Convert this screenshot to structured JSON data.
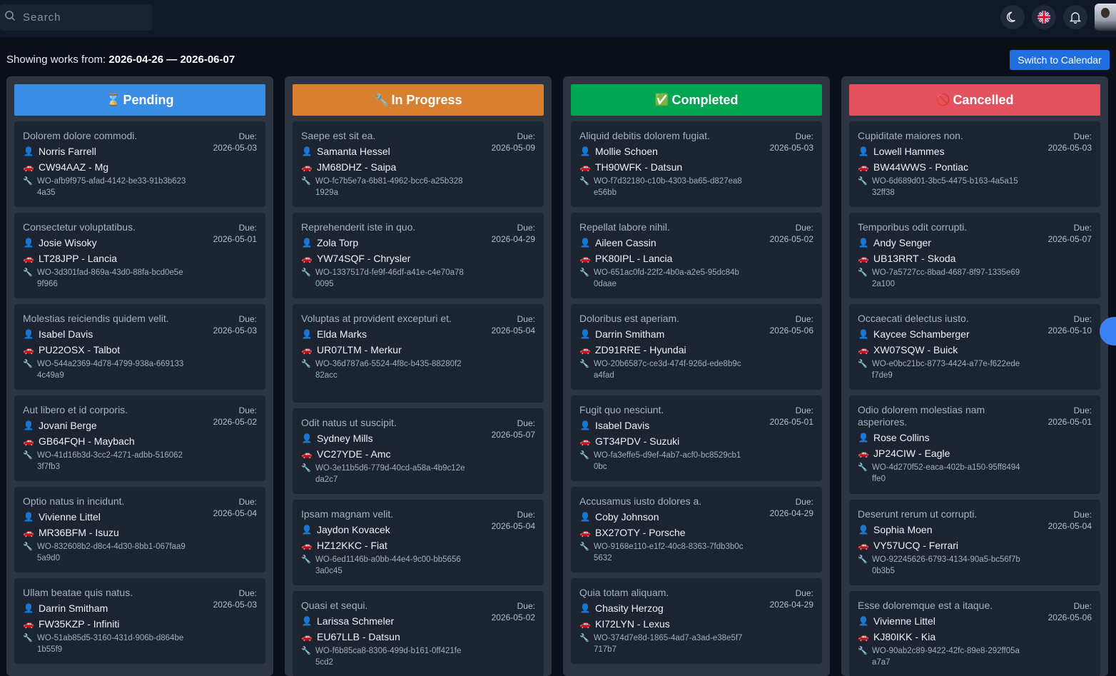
{
  "search": {
    "placeholder": "Search"
  },
  "header": {
    "prefix": "Showing works from: ",
    "range": "2026-04-26 — 2026-06-07",
    "switch_label": "Switch to Calendar"
  },
  "icons": {
    "theme": "moon-icon",
    "language": "uk-flag-icon",
    "notifications": "bell-icon"
  },
  "columns": [
    {
      "key": "pending",
      "label": "Pending",
      "emoji": "⌛",
      "color": "#3a8ee6",
      "cards": [
        {
          "title": "Dolorem dolore commodi.",
          "due_label": "Due:",
          "due": "2026-05-03",
          "person": "Norris Farrell",
          "vehicle": "CW94AAZ - Mg",
          "wo": "WO-afb9f975-afad-4142-be33-91b3b6234a35"
        },
        {
          "title": "Consectetur voluptatibus.",
          "due_label": "Due:",
          "due": "2026-05-01",
          "person": "Josie Wisoky",
          "vehicle": "LT28JPP - Lancia",
          "wo": "WO-3d301fad-869a-43d0-88fa-bcd0e5e9f966"
        },
        {
          "title": "Molestias reiciendis quidem velit.",
          "due_label": "Due:",
          "due": "2026-05-03",
          "person": "Isabel Davis",
          "vehicle": "PU22OSX - Talbot",
          "wo": "WO-544a2369-4d78-4799-938a-6691334c49a9"
        },
        {
          "title": "Aut libero et id corporis.",
          "due_label": "Due:",
          "due": "2026-05-02",
          "person": "Jovani Berge",
          "vehicle": "GB64FQH - Maybach",
          "wo": "WO-41d16b3d-3cc2-4271-adbb-5160623f7fb3"
        },
        {
          "title": "Optio natus in incidunt.",
          "due_label": "Due:",
          "due": "2026-05-04",
          "person": "Vivienne Littel",
          "vehicle": "MR36BFM - Isuzu",
          "wo": "WO-832608b2-d8c4-4d30-8bb1-067faa95a9d0"
        },
        {
          "title": "Ullam beatae quis natus.",
          "due_label": "Due:",
          "due": "2026-05-03",
          "person": "Darrin Smitham",
          "vehicle": "FW35KZP - Infiniti",
          "wo": "WO-51ab85d5-3160-431d-906b-d864be1b55f9"
        }
      ]
    },
    {
      "key": "in_progress",
      "label": "In Progress",
      "emoji": "🔧",
      "color": "#d98030",
      "cards": [
        {
          "title": "Saepe est sit ea.",
          "due_label": "Due:",
          "due": "2026-05-09",
          "person": "Samanta Hessel",
          "vehicle": "JM68DHZ - Saipa",
          "wo": "WO-fc7b5e7a-6b81-4962-bcc6-a25b3281929a"
        },
        {
          "title": "Reprehenderit iste in quo.",
          "due_label": "Due:",
          "due": "2026-04-29",
          "person": "Zola Torp",
          "vehicle": "YW74SQF - Chrysler",
          "wo": "WO-1337517d-fe9f-46df-a41e-c4e70a780095"
        },
        {
          "title": "Voluptas at provident excepturi et.",
          "due_label": "Due:",
          "due": "2026-05-04",
          "person": "Elda Marks",
          "vehicle": "UR07LTM - Merkur",
          "wo": "WO-36d787a6-5524-4f8c-b435-88280f282acc"
        },
        {
          "title": "Odit natus ut suscipit.",
          "due_label": "Due:",
          "due": "2026-05-07",
          "person": "Sydney Mills",
          "vehicle": "VC27YDE - Amc",
          "wo": "WO-3e11b5d6-779d-40cd-a58a-4b9c12eda2c7"
        },
        {
          "title": "Ipsam magnam velit.",
          "due_label": "Due:",
          "due": "2026-05-04",
          "person": "Jaydon Kovacek",
          "vehicle": "HZ12KKC - Fiat",
          "wo": "WO-6ed1146b-a0bb-44e4-9c00-bb56563a0c45"
        },
        {
          "title": "Quasi et sequi.",
          "due_label": "Due:",
          "due": "2026-05-02",
          "person": "Larissa Schmeler",
          "vehicle": "EU67LLB - Datsun",
          "wo": "WO-f6b85ca8-8306-499d-b161-0ff421fe5cd2"
        }
      ]
    },
    {
      "key": "completed",
      "label": "Completed",
      "emoji": "✅",
      "color": "#00a651",
      "cards": [
        {
          "title": "Aliquid debitis dolorem fugiat.",
          "due_label": "Due:",
          "due": "2026-05-03",
          "person": "Mollie Schoen",
          "vehicle": "TH90WFK - Datsun",
          "wo": "WO-f7d32180-c10b-4303-ba65-d827ea8e56bb"
        },
        {
          "title": "Repellat labore nihil.",
          "due_label": "Due:",
          "due": "2026-05-02",
          "person": "Aileen Cassin",
          "vehicle": "PK80IPL - Lancia",
          "wo": "WO-651ac0fd-22f2-4b0a-a2e5-95dc84b0daae"
        },
        {
          "title": "Doloribus est aperiam.",
          "due_label": "Due:",
          "due": "2026-05-06",
          "person": "Darrin Smitham",
          "vehicle": "ZD91RRE - Hyundai",
          "wo": "WO-20b6587c-ce3d-474f-926d-ede8b9ca4fad"
        },
        {
          "title": "Fugit quo nesciunt.",
          "due_label": "Due:",
          "due": "2026-05-01",
          "person": "Isabel Davis",
          "vehicle": "GT34PDV - Suzuki",
          "wo": "WO-fa3effe5-d9ef-4ab7-acf0-bc8529cb10bc"
        },
        {
          "title": "Accusamus iusto dolores a.",
          "due_label": "Due:",
          "due": "2026-04-29",
          "person": "Coby Johnson",
          "vehicle": "BX27OTY - Porsche",
          "wo": "WO-9168e110-e1f2-40c8-8363-7fdb3b0c5632"
        },
        {
          "title": "Quia totam aliquam.",
          "due_label": "Due:",
          "due": "2026-04-29",
          "person": "Chasity Herzog",
          "vehicle": "KI72LYN - Lexus",
          "wo": "WO-374d7e8d-1865-4ad7-a3ad-e38e5f7717b7"
        }
      ]
    },
    {
      "key": "cancelled",
      "label": "Cancelled",
      "emoji": "🚫",
      "color": "#e5525f",
      "cards": [
        {
          "title": "Cupiditate maiores non.",
          "due_label": "Due:",
          "due": "2026-05-03",
          "person": "Lowell Hammes",
          "vehicle": "BW44WWS - Pontiac",
          "wo": "WO-6d689d01-3bc5-4475-b163-4a5a1532ff38"
        },
        {
          "title": "Temporibus odit corrupti.",
          "due_label": "Due:",
          "due": "2026-05-07",
          "person": "Andy Senger",
          "vehicle": "UB13RRT - Skoda",
          "wo": "WO-7a5727cc-8bad-4687-8f97-1335e692a100"
        },
        {
          "title": "Occaecati delectus iusto.",
          "due_label": "Due:",
          "due": "2026-05-10",
          "person": "Kaycee Schamberger",
          "vehicle": "XW07SQW - Buick",
          "wo": "WO-e0bc21bc-8773-4424-a77e-f622edef7de9"
        },
        {
          "title": "Odio dolorem molestias nam asperiores.",
          "due_label": "Due:",
          "due": "2026-05-01",
          "person": "Rose Collins",
          "vehicle": "JP24CIW - Eagle",
          "wo": "WO-4d270f52-eaca-402b-a150-95ff8494ffe0"
        },
        {
          "title": "Deserunt rerum ut corrupti.",
          "due_label": "Due:",
          "due": "2026-05-04",
          "person": "Sophia Moen",
          "vehicle": "VY57UCQ - Ferrari",
          "wo": "WO-92245626-6793-4134-90a5-bc56f7b0b3b5"
        },
        {
          "title": "Esse doloremque est a itaque.",
          "due_label": "Due:",
          "due": "2026-05-06",
          "person": "Vivienne Littel",
          "vehicle": "KJ80IKK - Kia",
          "wo": "WO-90ab2c89-9422-42fc-89e8-292ff05aa7a7"
        }
      ]
    }
  ]
}
